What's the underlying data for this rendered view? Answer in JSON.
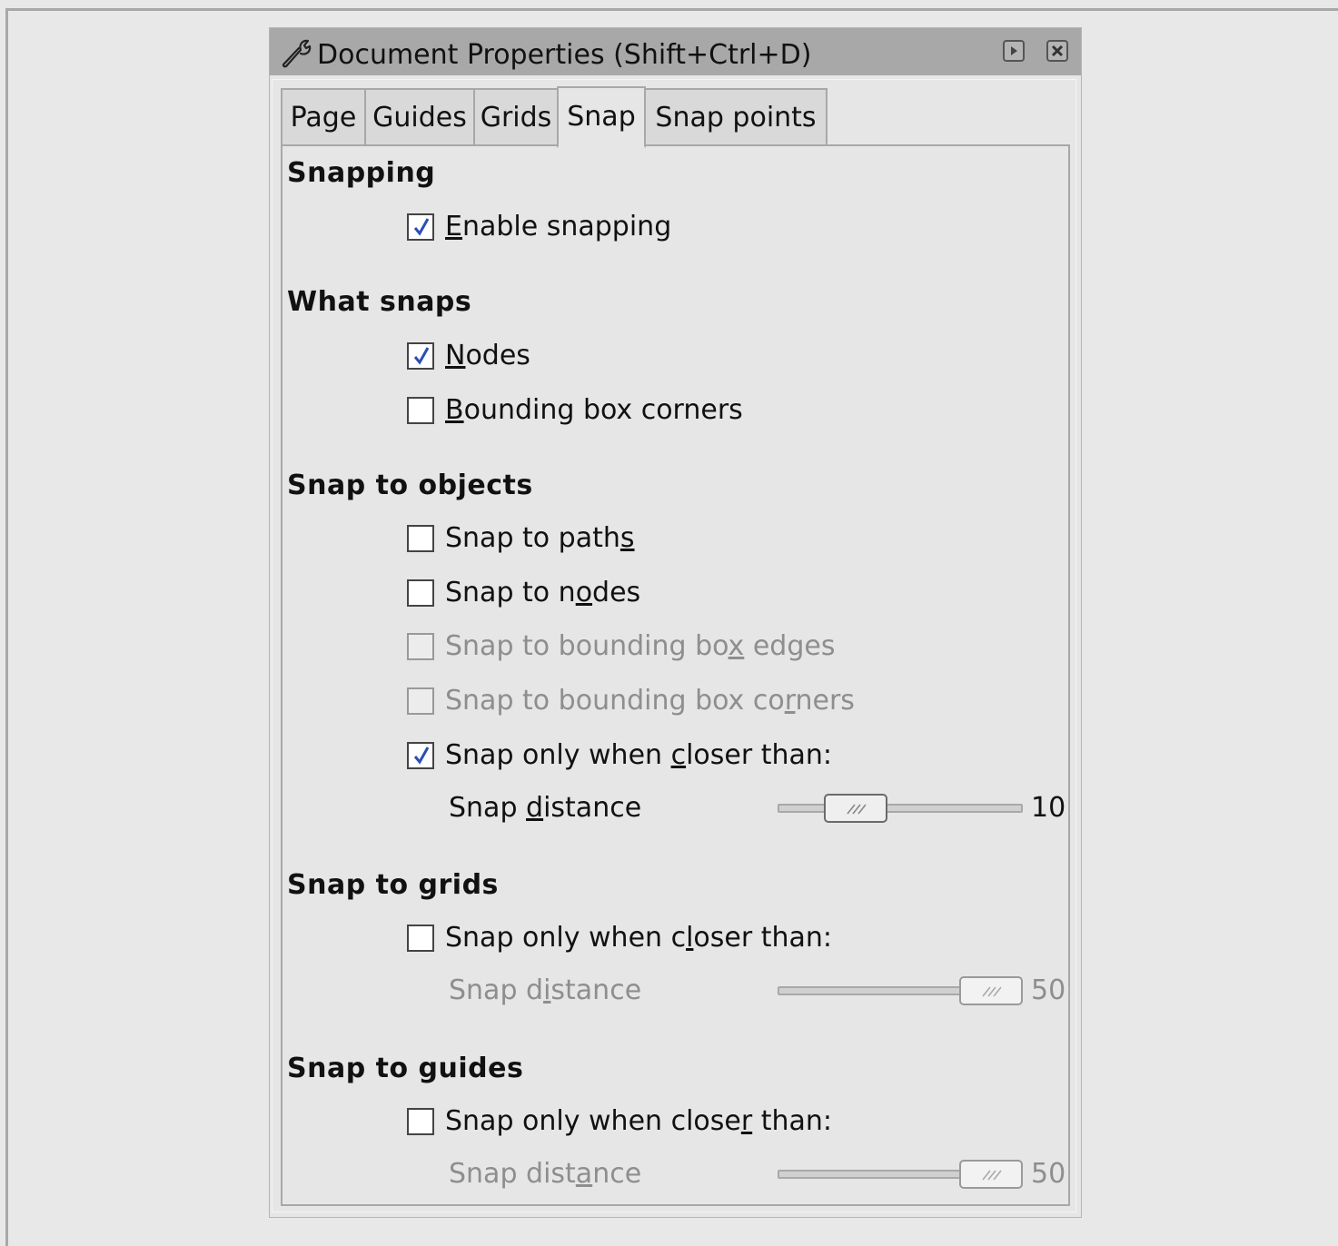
{
  "window": {
    "title": "Document Properties (Shift+Ctrl+D)"
  },
  "tabs": [
    "Page",
    "Guides",
    "Grids",
    "Snap",
    "Snap points"
  ],
  "active_tab": "Snap",
  "sections": {
    "snapping": {
      "heading": "Snapping",
      "enable": {
        "pre": "",
        "u": "E",
        "post": "nable snapping",
        "checked": true
      }
    },
    "what_snaps": {
      "heading": "What snaps",
      "nodes": {
        "pre": "",
        "u": "N",
        "post": "odes",
        "checked": true
      },
      "bbox_corners": {
        "pre": "",
        "u": "B",
        "post": "ounding box corners",
        "checked": false
      }
    },
    "snap_to_objects": {
      "heading": "Snap to objects",
      "paths": {
        "pre": "Snap to path",
        "u": "s",
        "post": "",
        "checked": false
      },
      "nodes": {
        "pre": "Snap to n",
        "u": "o",
        "post": "des",
        "checked": false
      },
      "bbox_edges": {
        "pre": "Snap to bounding bo",
        "u": "x",
        "post": " edges",
        "checked": false,
        "disabled": true
      },
      "bbox_corners": {
        "pre": "Snap to bounding box co",
        "u": "r",
        "post": "ners",
        "checked": false,
        "disabled": true
      },
      "closer": {
        "pre": "Snap only when ",
        "u": "c",
        "post": "loser than:",
        "checked": true
      },
      "distance": {
        "pre": "Snap ",
        "u": "d",
        "post": "istance",
        "value": "10",
        "fraction": 0.1
      }
    },
    "snap_to_grids": {
      "heading": "Snap to grids",
      "closer": {
        "pre": "Snap only when c",
        "u": "l",
        "post": "oser than:",
        "checked": false
      },
      "distance": {
        "pre": "Snap d",
        "u": "i",
        "post": "stance",
        "value": "50",
        "fraction": 1.0,
        "disabled": true
      }
    },
    "snap_to_guides": {
      "heading": "Snap to guides",
      "closer": {
        "pre": "Snap only when close",
        "u": "r",
        "post": " than:",
        "checked": false
      },
      "distance": {
        "pre": "Snap dist",
        "u": "a",
        "post": "nce",
        "value": "50",
        "fraction": 1.0,
        "disabled": true
      }
    }
  },
  "colors": {
    "titlebar": "#a8a8a8",
    "dialog_bg": "#e6e6e6",
    "checkmark": "#2a4fb5",
    "disabled_text": "#8e8e8e"
  },
  "icons": {
    "title": "wrench-icon",
    "shade": "shade-icon",
    "close": "close-icon",
    "check": "checkmark-icon",
    "grip": "grip-icon"
  }
}
